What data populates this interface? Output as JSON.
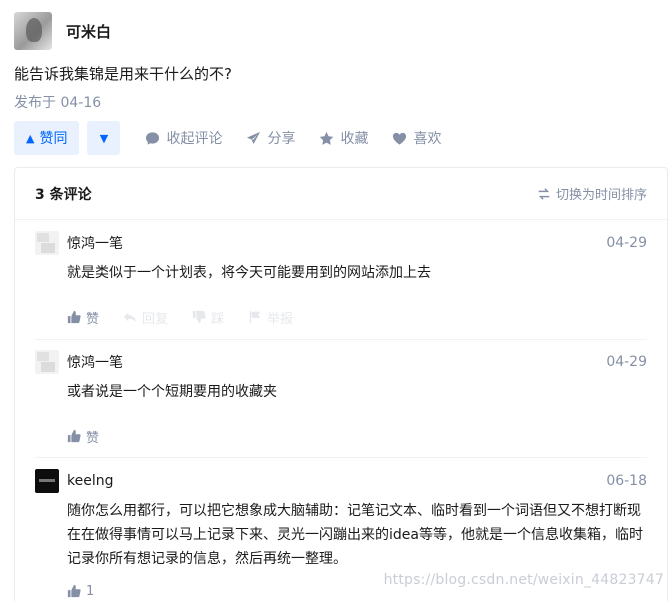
{
  "author": {
    "name": "可米白"
  },
  "question": {
    "text": "能告诉我集锦是用来干什么的不?",
    "published": "发布于 04-16"
  },
  "actions": {
    "vote_up_label": "赞同",
    "collapse_comments": "收起评论",
    "share": "分享",
    "collect": "收藏",
    "like": "喜欢"
  },
  "comments_panel": {
    "count_label": "3 条评论",
    "sort_toggle": "切换为时间排序",
    "items": [
      {
        "name": "惊鸿一笔",
        "date": "04-29",
        "text": "就是类似于一个计划表，将今天可能要用到的网站添加上去",
        "like_label": "赞",
        "reply_label": "回复",
        "dislike_label": "踩",
        "report_label": "举报"
      },
      {
        "name": "惊鸿一笔",
        "date": "04-29",
        "text": "或者说是一个个短期要用的收藏夹",
        "like_label": "赞"
      },
      {
        "name": "keelng",
        "date": "06-18",
        "text": "随你怎么用都行，可以把它想象成大脑辅助：记笔记文本、临时看到一个词语但又不想打断现在在做得事情可以马上记录下来、灵光一闪蹦出来的idea等等，他就是一个信息收集箱，临时记录你所有想记录的信息，然后再统一整理。",
        "like_label": "1"
      }
    ]
  },
  "watermark": "https://blog.csdn.net/weixin_44823747",
  "colors": {
    "accent": "#0066ff",
    "accent_bg": "#e8f1fd",
    "muted": "#8590a6"
  }
}
